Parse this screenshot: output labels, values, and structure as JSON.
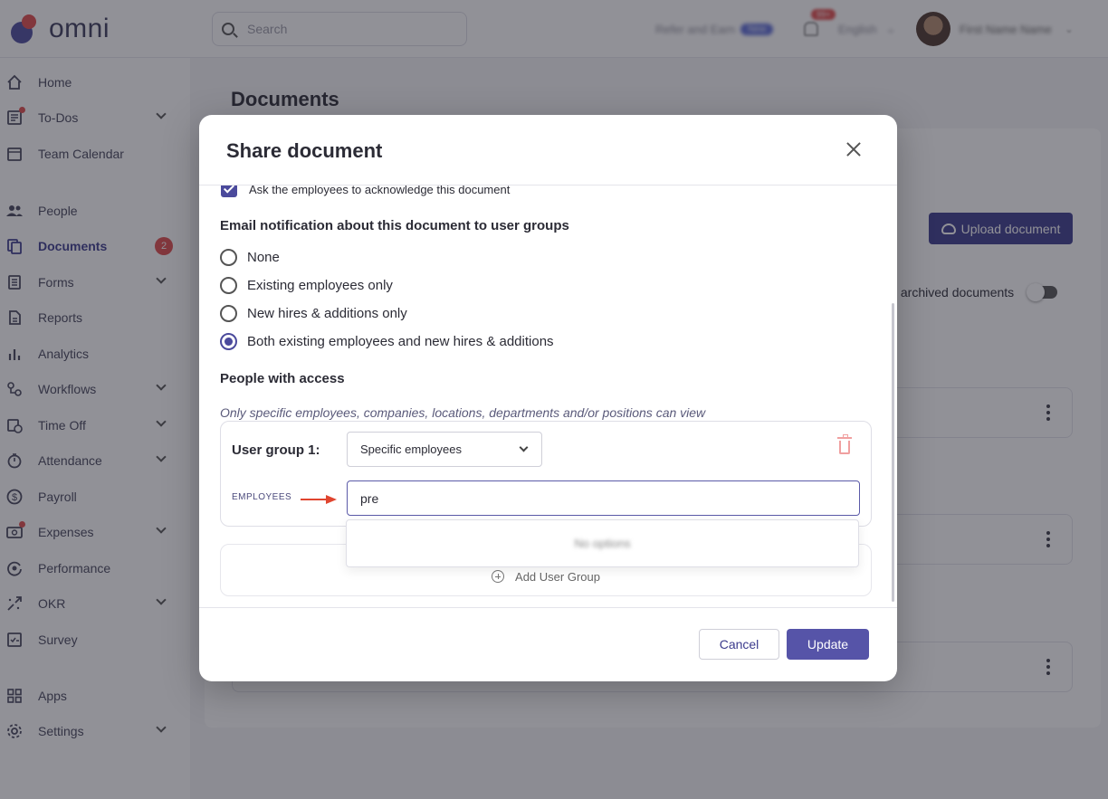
{
  "app": {
    "logo_text": "omni"
  },
  "topbar": {
    "search_placeholder": "Search",
    "refer_label": "Refer and Earn",
    "refer_badge": "New",
    "notif_count": "99+",
    "language": "English",
    "user_name": "First Name Name"
  },
  "sidebar": {
    "items": [
      {
        "label": "Home",
        "icon": "home-icon"
      },
      {
        "label": "To-Dos",
        "icon": "todo-icon"
      },
      {
        "label": "Team Calendar",
        "icon": "calendar-icon"
      },
      {
        "label": "People",
        "icon": "people-icon"
      },
      {
        "label": "Documents",
        "icon": "documents-icon",
        "count": "2"
      },
      {
        "label": "Forms",
        "icon": "forms-icon"
      },
      {
        "label": "Reports",
        "icon": "reports-icon"
      },
      {
        "label": "Analytics",
        "icon": "analytics-icon"
      },
      {
        "label": "Workflows",
        "icon": "workflows-icon"
      },
      {
        "label": "Time Off",
        "icon": "time-off-icon"
      },
      {
        "label": "Attendance",
        "icon": "attendance-icon"
      },
      {
        "label": "Payroll",
        "icon": "payroll-icon"
      },
      {
        "label": "Expenses",
        "icon": "expenses-icon"
      },
      {
        "label": "Performance",
        "icon": "performance-icon"
      },
      {
        "label": "OKR",
        "icon": "okr-icon"
      },
      {
        "label": "Survey",
        "icon": "survey-icon"
      },
      {
        "label": "Apps",
        "icon": "apps-icon"
      },
      {
        "label": "Settings",
        "icon": "settings-icon"
      }
    ]
  },
  "page": {
    "title": "Documents",
    "upload_label": "Upload document",
    "archived_label": "y archived documents"
  },
  "modal": {
    "title": "Share document",
    "ack_label": "Ask the employees to acknowledge this document",
    "email_heading": "Email notification about this document to user groups",
    "options": [
      "None",
      "Existing employees only",
      "New hires & additions only",
      "Both existing employees and new hires & additions"
    ],
    "selected_option": "Both existing employees and new hires & additions",
    "access_heading": "People with access",
    "access_note": "Only specific employees, companies, locations, departments and/or positions can view",
    "group_label": "User group 1:",
    "group_select_value": "Specific employees",
    "employees_label": "EMPLOYEES",
    "employees_input_value": "pre",
    "dropdown_text": "No options",
    "add_group_label": "Add User Group",
    "cancel_label": "Cancel",
    "update_label": "Update"
  },
  "colors": {
    "accent": "#3b3a8c",
    "button_primary": "#5654a8",
    "danger": "#e14b4b",
    "arrow": "#e0452f"
  }
}
